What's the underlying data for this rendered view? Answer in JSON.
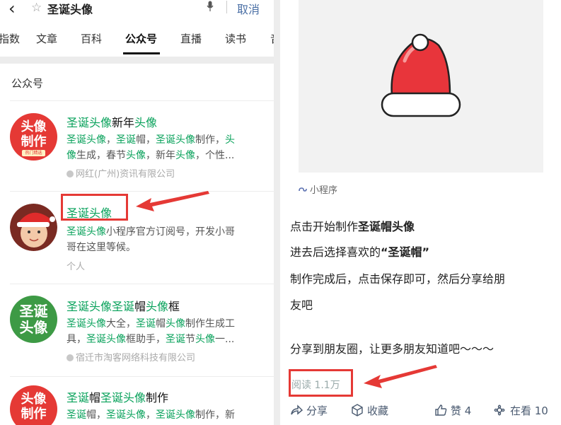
{
  "search": {
    "query": "圣诞头像",
    "cancel": "取消"
  },
  "tabs": [
    "指数",
    "文章",
    "百科",
    "公众号",
    "直播",
    "读书",
    "音"
  ],
  "section_title": "公众号",
  "results": [
    {
      "title": [
        [
          "圣诞头像",
          "hl"
        ],
        [
          "新年",
          ""
        ],
        [
          "头像",
          "hl"
        ]
      ],
      "desc": [
        [
          "圣诞头像",
          "hl"
        ],
        [
          "，",
          ""
        ],
        [
          "圣诞",
          "hl"
        ],
        [
          "帽，",
          ""
        ],
        [
          "圣诞头像",
          "hl"
        ],
        [
          "制作，",
          ""
        ],
        [
          "头",
          "hl"
        ],
        [
          "\n",
          ""
        ],
        [
          "像",
          "hl"
        ],
        [
          "生成，春节",
          ""
        ],
        [
          "头像",
          "hl"
        ],
        [
          "，新年",
          ""
        ],
        [
          "头像",
          "hl"
        ],
        [
          "，个性...",
          ""
        ]
      ],
      "source": "网红(广州)资讯有限公司",
      "avatar_text": [
        "头像",
        "制作",
        "热门精选"
      ]
    },
    {
      "title": [
        [
          "圣诞头像",
          "hl"
        ]
      ],
      "desc": [
        [
          "圣诞头像",
          "hl"
        ],
        [
          "小程序官方订阅号，开发小哥\n哥在这里等候。",
          ""
        ]
      ],
      "source": "个人"
    },
    {
      "title": [
        [
          "圣诞头像圣诞",
          "hl"
        ],
        [
          "帽",
          ""
        ],
        [
          "头像",
          "hl"
        ],
        [
          "框",
          ""
        ]
      ],
      "desc": [
        [
          "圣诞头像",
          "hl"
        ],
        [
          "大全，",
          ""
        ],
        [
          "圣诞",
          "hl"
        ],
        [
          "帽",
          ""
        ],
        [
          "头像",
          "hl"
        ],
        [
          "制作生成工\n具，",
          ""
        ],
        [
          "圣诞头像",
          "hl"
        ],
        [
          "框助手，",
          ""
        ],
        [
          "圣诞",
          "hl"
        ],
        [
          "节",
          ""
        ],
        [
          "头像",
          "hl"
        ],
        [
          "一...",
          ""
        ]
      ],
      "source": "宿迁市淘客网络科技有限公司",
      "avatar_text": [
        "圣诞",
        "头像"
      ]
    },
    {
      "title": [
        [
          "圣诞",
          "hl"
        ],
        [
          "帽",
          ""
        ],
        [
          "圣诞头像",
          "hl"
        ],
        [
          "制作",
          ""
        ]
      ],
      "desc": [
        [
          "圣诞",
          "hl"
        ],
        [
          "帽，",
          ""
        ],
        [
          "圣诞头像",
          "hl"
        ],
        [
          "，",
          ""
        ],
        [
          "圣诞头像",
          "hl"
        ],
        [
          "制作，新",
          ""
        ]
      ],
      "avatar_text": [
        "头像",
        "制作"
      ]
    }
  ],
  "article": {
    "mini_program_label": "小程序",
    "lines": [
      [
        [
          "点击开始制作",
          ""
        ],
        [
          "圣诞帽头像",
          "b"
        ]
      ],
      [
        [
          "进去后选择喜欢的",
          ""
        ],
        [
          "“圣诞帽”",
          "b"
        ]
      ],
      [
        [
          "制作完成后，点击保存即可，然后分享给朋",
          ""
        ]
      ],
      [
        [
          "友吧",
          ""
        ]
      ],
      [
        [
          "分享到朋友圈，让更多朋友知道吧～～～",
          ""
        ]
      ]
    ],
    "read_count": "阅读 1.1万",
    "actions": {
      "share": "分享",
      "favorite": "收藏",
      "like": "赞 4",
      "watching": "在看 10"
    }
  },
  "colors": {
    "highlight": "#07a15a",
    "annotation": "#e53935",
    "link": "#4a6fa5"
  }
}
